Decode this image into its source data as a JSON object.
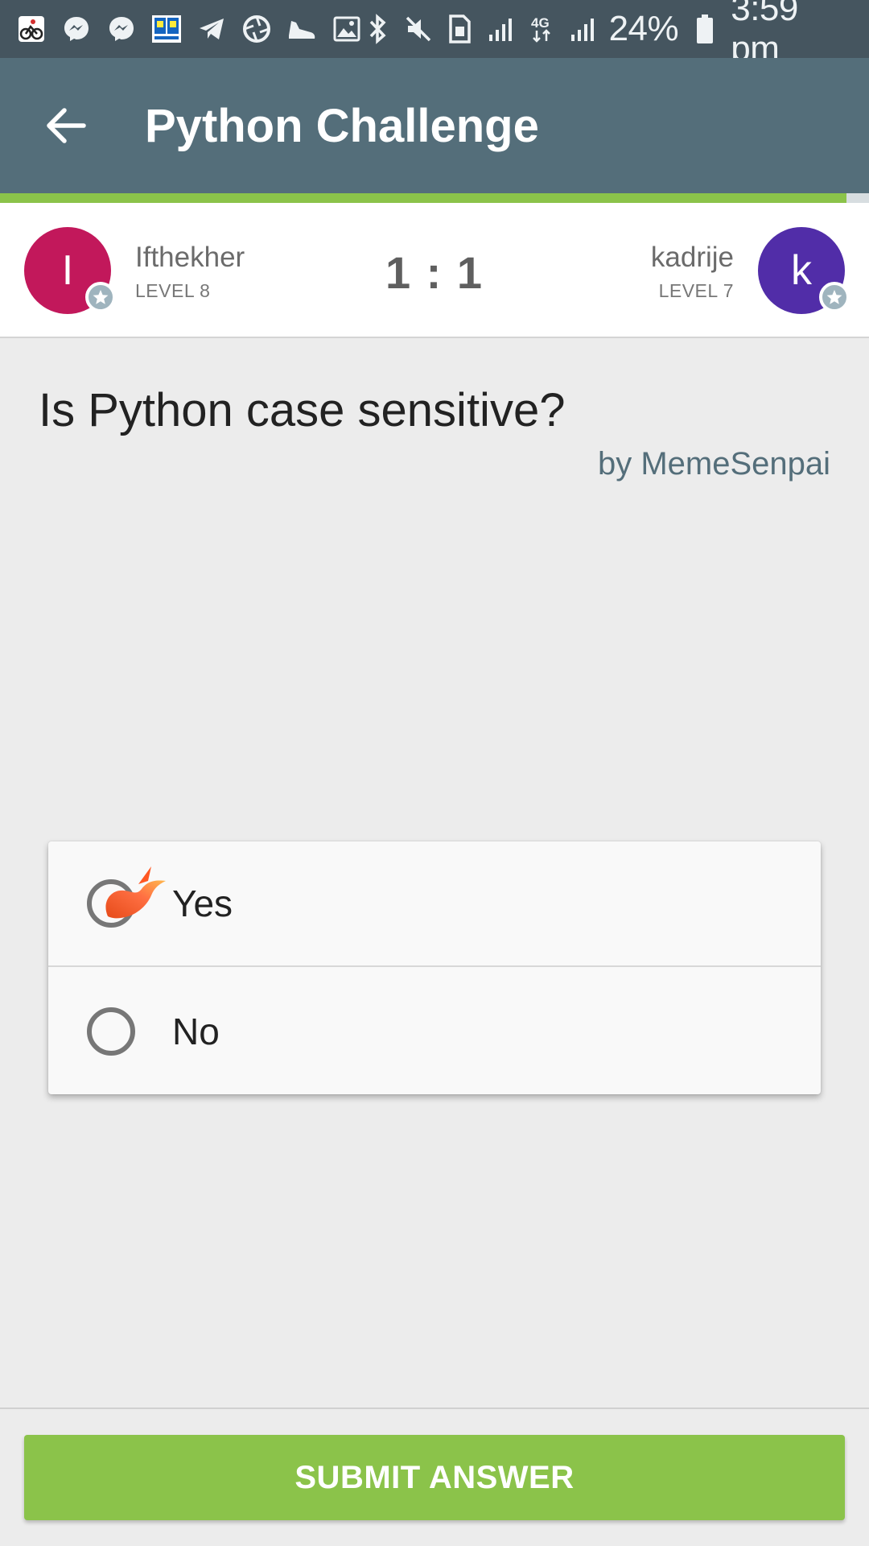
{
  "status_bar": {
    "left_icons": [
      "cycling-app-icon",
      "messenger-icon",
      "messenger-icon",
      "dictionary-app-icon",
      "telegram-icon",
      "shutter-app-icon",
      "shoe-app-icon",
      "gallery-icon"
    ],
    "right_icons": [
      "bluetooth-icon",
      "mute-icon",
      "sim-icon",
      "signal-icon",
      "4g-icon",
      "signal-icon"
    ],
    "battery": "24%",
    "time": "3:59 pm"
  },
  "app_bar": {
    "title": "Python Challenge",
    "back_icon": "arrow-left-icon",
    "progress_color": "#8bc34a"
  },
  "players": {
    "left": {
      "initial": "I",
      "name": "Ifthekher",
      "level": "LEVEL 8",
      "color": "#c2185b"
    },
    "right": {
      "initial": "k",
      "name": "kadrije",
      "level": "LEVEL 7",
      "color": "#512da8"
    },
    "score": "1 : 1"
  },
  "question": {
    "text": "Is Python case sensitive?",
    "author": "by MemeSenpai"
  },
  "answers": [
    {
      "label": "Yes",
      "selected": true
    },
    {
      "label": "No",
      "selected": false
    }
  ],
  "submit": {
    "label": "SUBMIT ANSWER",
    "color": "#8bc34a"
  }
}
